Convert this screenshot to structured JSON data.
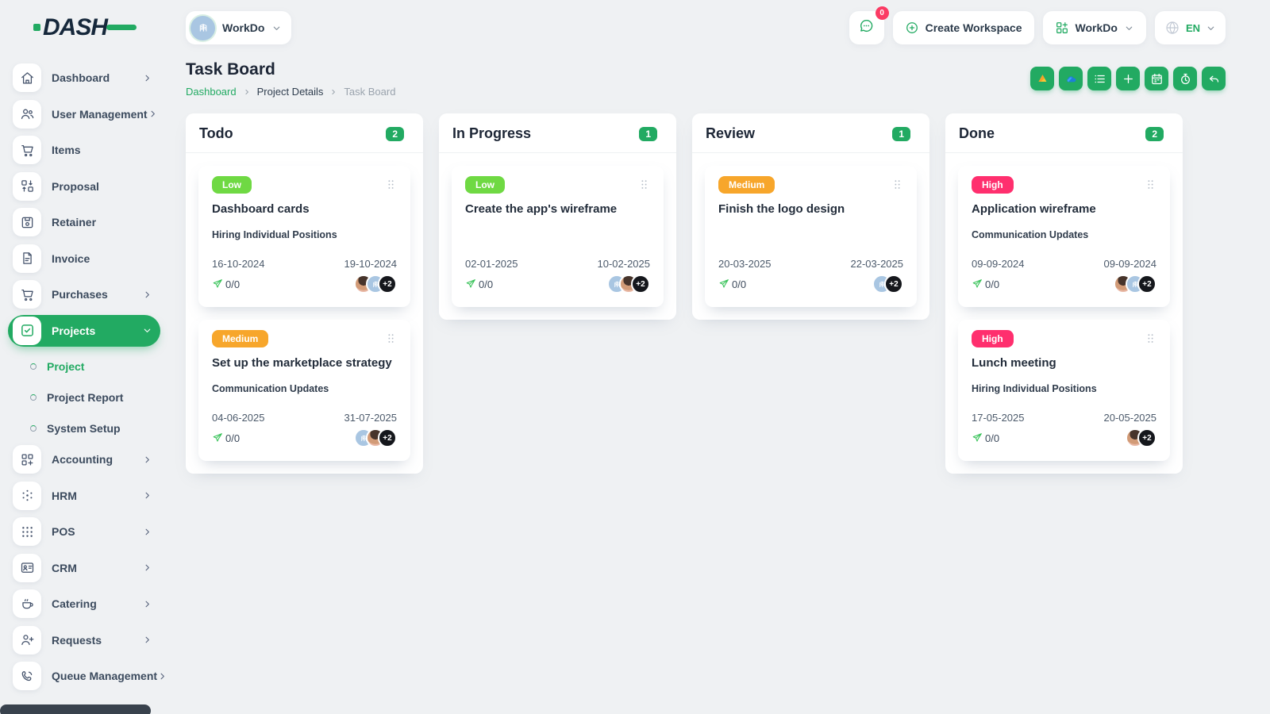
{
  "colors": {
    "primary": "#22aa62",
    "page_bg": "#eff1f3",
    "badge_red": "#fb3b64",
    "low": "#6fd943",
    "medium": "#f7a62b",
    "high": "#ff2f6e"
  },
  "brand": {
    "logo_text": "DASH"
  },
  "topbar": {
    "workspace_switcher": {
      "label": "WorkDo",
      "avatar": "building-icon"
    },
    "messages": {
      "icon": "chat-icon",
      "badge_count": "0"
    },
    "create_workspace_label": "Create Workspace",
    "workspace_menu_label": "WorkDo",
    "language": "EN"
  },
  "sidebar": {
    "items": [
      {
        "label": "Dashboard",
        "icon": "home-icon",
        "chevron": "right"
      },
      {
        "label": "User Management",
        "icon": "users-icon",
        "chevron": "right"
      },
      {
        "label": "Items",
        "icon": "cart-icon",
        "chevron": ""
      },
      {
        "label": "Proposal",
        "icon": "proposal-icon",
        "chevron": ""
      },
      {
        "label": "Retainer",
        "icon": "retainer-icon",
        "chevron": ""
      },
      {
        "label": "Invoice",
        "icon": "invoice-icon",
        "chevron": ""
      },
      {
        "label": "Purchases",
        "icon": "purchases-icon",
        "chevron": "right"
      },
      {
        "label": "Projects",
        "icon": "check-square-icon",
        "chevron": "down",
        "active": true,
        "children": [
          {
            "label": "Project",
            "active": true
          },
          {
            "label": "Project Report",
            "active": false
          },
          {
            "label": "System Setup",
            "active": false
          }
        ]
      },
      {
        "label": "Accounting",
        "icon": "accounting-icon",
        "chevron": "right"
      },
      {
        "label": "HRM",
        "icon": "hrm-icon",
        "chevron": "right"
      },
      {
        "label": "POS",
        "icon": "pos-icon",
        "chevron": "right"
      },
      {
        "label": "CRM",
        "icon": "crm-icon",
        "chevron": "right"
      },
      {
        "label": "Catering",
        "icon": "catering-icon",
        "chevron": "right"
      },
      {
        "label": "Requests",
        "icon": "user-plus-icon",
        "chevron": "right"
      },
      {
        "label": "Queue Management",
        "icon": "phone-icon",
        "chevron": "right"
      }
    ]
  },
  "page": {
    "title": "Task Board",
    "breadcrumb": [
      {
        "label": "Dashboard",
        "type": "link"
      },
      {
        "label": "Project Details",
        "type": "link-dark"
      },
      {
        "label": "Task Board",
        "type": "current"
      }
    ],
    "actions": [
      {
        "name": "google-drive-button",
        "icon": "google-drive-icon"
      },
      {
        "name": "onedrive-button",
        "icon": "onedrive-icon"
      },
      {
        "name": "list-view-button",
        "icon": "list-icon"
      },
      {
        "name": "add-task-button",
        "icon": "plus-icon"
      },
      {
        "name": "calendar-button",
        "icon": "calendar-icon"
      },
      {
        "name": "timer-button",
        "icon": "timer-icon"
      },
      {
        "name": "back-button",
        "icon": "undo-icon"
      }
    ]
  },
  "board": {
    "columns": [
      {
        "title": "Todo",
        "count": "2",
        "cards": [
          {
            "priority": "Low",
            "priority_key": "low",
            "title": "Dashboard cards",
            "milestone": "Hiring Individual Positions",
            "start_date": "16-10-2024",
            "due_date": "19-10-2024",
            "progress": "0/0",
            "avatars": [
              "photo",
              "org"
            ],
            "extra_count": "+2"
          },
          {
            "priority": "Medium",
            "priority_key": "medium",
            "title": "Set up the marketplace strategy",
            "milestone": "Communication Updates",
            "start_date": "04-06-2025",
            "due_date": "31-07-2025",
            "progress": "0/0",
            "avatars": [
              "org",
              "photo"
            ],
            "extra_count": "+2"
          }
        ]
      },
      {
        "title": "In Progress",
        "count": "1",
        "cards": [
          {
            "priority": "Low",
            "priority_key": "low",
            "title": "Create the app's wireframe",
            "milestone": "",
            "start_date": "02-01-2025",
            "due_date": "10-02-2025",
            "progress": "0/0",
            "avatars": [
              "org",
              "photo"
            ],
            "extra_count": "+2"
          }
        ]
      },
      {
        "title": "Review",
        "count": "1",
        "cards": [
          {
            "priority": "Medium",
            "priority_key": "medium",
            "title": "Finish the logo design",
            "milestone": "",
            "start_date": "20-03-2025",
            "due_date": "22-03-2025",
            "progress": "0/0",
            "avatars": [
              "org"
            ],
            "extra_count": "+2"
          }
        ]
      },
      {
        "title": "Done",
        "count": "2",
        "cards": [
          {
            "priority": "High",
            "priority_key": "high",
            "title": "Application wireframe",
            "milestone": "Communication Updates",
            "start_date": "09-09-2024",
            "due_date": "09-09-2024",
            "progress": "0/0",
            "avatars": [
              "photo",
              "org"
            ],
            "extra_count": "+2"
          },
          {
            "priority": "High",
            "priority_key": "high",
            "title": "Lunch meeting",
            "milestone": "Hiring Individual Positions",
            "start_date": "17-05-2025",
            "due_date": "20-05-2025",
            "progress": "0/0",
            "avatars": [
              "photo"
            ],
            "extra_count": "+2"
          }
        ]
      }
    ]
  }
}
